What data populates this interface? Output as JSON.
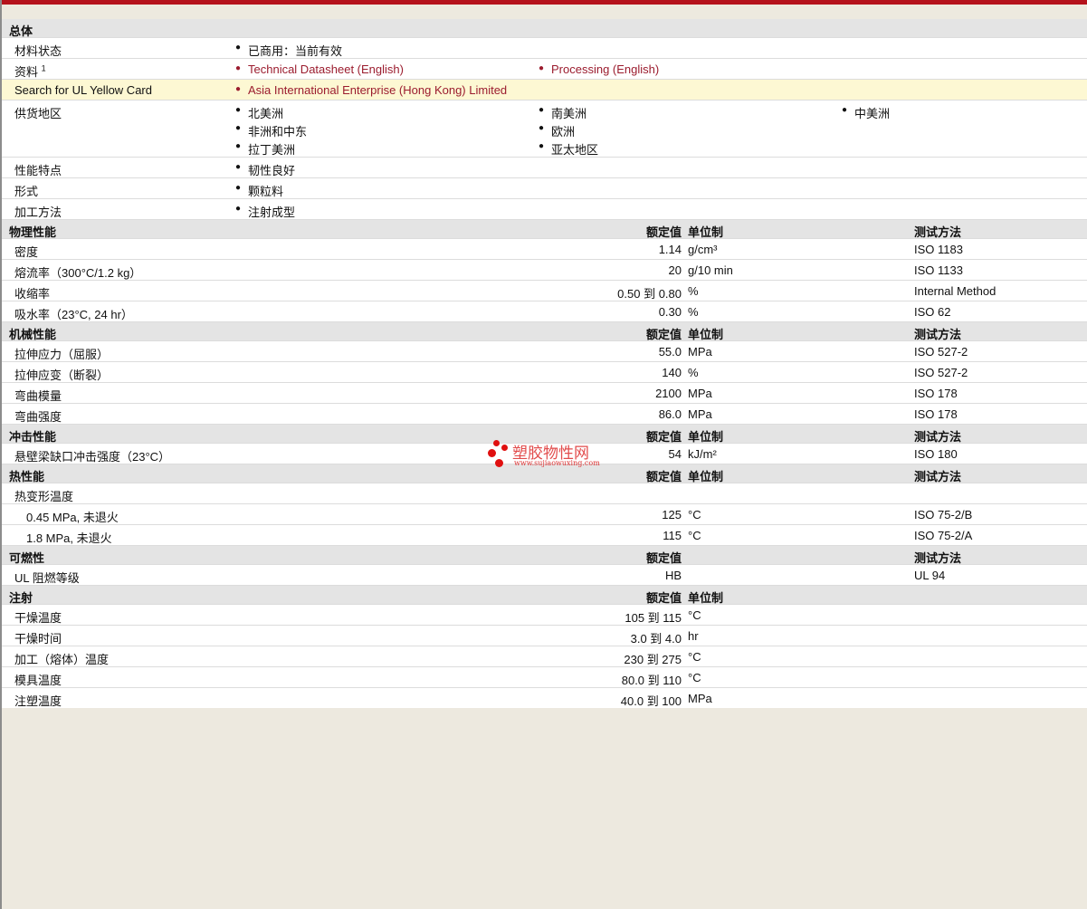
{
  "general": {
    "title": "总体",
    "status_label": "材料状态",
    "status_value": "已商用：当前有效",
    "docs_label": "资料",
    "docs_sup": "1",
    "doc_links": [
      "Technical Datasheet (English)",
      "Processing (English)"
    ],
    "ul_label": "Search for UL Yellow Card",
    "ul_value": "Asia International Enterprise (Hong Kong) Limited",
    "regions_label": "供货地区",
    "regions": [
      "北美洲",
      "南美洲",
      "中美洲",
      "非洲和中东",
      "欧洲",
      "拉丁美洲",
      "亚太地区"
    ],
    "features_label": "性能特点",
    "features_value": "韧性良好",
    "form_label": "形式",
    "form_value": "颗粒料",
    "process_label": "加工方法",
    "process_value": "注射成型"
  },
  "headers": {
    "value": "额定值",
    "unit": "单位制",
    "method": "测试方法"
  },
  "physical": {
    "title": "物理性能",
    "rows": [
      {
        "label": "密度",
        "value": "1.14",
        "unit": "g/cm³",
        "method": "ISO 1183"
      },
      {
        "label": "熔流率（300°C/1.2 kg）",
        "value": "20",
        "unit": "g/10 min",
        "method": "ISO 1133"
      },
      {
        "label": "收缩率",
        "value": "0.50 到  0.80",
        "unit": "%",
        "method": "Internal Method"
      },
      {
        "label": "吸水率（23°C, 24 hr）",
        "value": "0.30",
        "unit": "%",
        "method": "ISO 62"
      }
    ]
  },
  "mechanical": {
    "title": "机械性能",
    "rows": [
      {
        "label": "拉伸应力（屈服）",
        "value": "55.0",
        "unit": "MPa",
        "method": "ISO 527-2"
      },
      {
        "label": "拉伸应变（断裂）",
        "value": "140",
        "unit": "%",
        "method": "ISO 527-2"
      },
      {
        "label": "弯曲模量",
        "value": "2100",
        "unit": "MPa",
        "method": "ISO 178"
      },
      {
        "label": "弯曲强度",
        "value": "86.0",
        "unit": "MPa",
        "method": "ISO 178"
      }
    ]
  },
  "impact": {
    "title": "冲击性能",
    "rows": [
      {
        "label": "悬壁梁缺口冲击强度（23°C）",
        "value": "54",
        "unit": "kJ/m²",
        "method": "ISO 180"
      }
    ]
  },
  "thermal": {
    "title": "热性能",
    "group_label": "热变形温度",
    "rows": [
      {
        "label": "0.45 MPa, 未退火",
        "value": "125",
        "unit": "°C",
        "method": "ISO 75-2/B"
      },
      {
        "label": "1.8 MPa, 未退火",
        "value": "115",
        "unit": "°C",
        "method": "ISO 75-2/A"
      }
    ]
  },
  "flammability": {
    "title": "可燃性",
    "rows": [
      {
        "label": "UL 阻燃等级",
        "value": "HB",
        "unit": "",
        "method": "UL 94"
      }
    ]
  },
  "injection": {
    "title": "注射",
    "rows": [
      {
        "label": "干燥温度",
        "value": "105 到  115",
        "unit": "°C"
      },
      {
        "label": "干燥时间",
        "value": "3.0 到  4.0",
        "unit": "hr"
      },
      {
        "label": "加工（熔体）温度",
        "value": "230 到  275",
        "unit": "°C"
      },
      {
        "label": "模具温度",
        "value": "80.0 到  110",
        "unit": "°C"
      },
      {
        "label": "注塑温度",
        "value": "40.0 到  100",
        "unit": "MPa"
      }
    ]
  },
  "watermark": {
    "text": "塑胶物性网",
    "url": "www.sujiaowuxing.com",
    "color": "#e01010"
  },
  "colors": {
    "accent": "#b5121b",
    "link": "#9b1c2e",
    "highlight": "#fdf8d3"
  }
}
